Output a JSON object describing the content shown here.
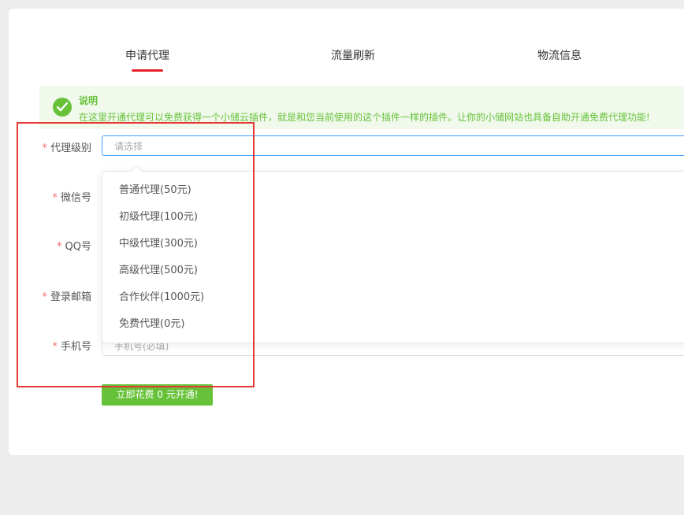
{
  "tabs": [
    {
      "label": "申请代理"
    },
    {
      "label": "流量刷新"
    },
    {
      "label": "物流信息"
    }
  ],
  "notice": {
    "title": "说明",
    "text": "在这里开通代理可以免费获得一个小储云插件，就是和您当前使用的这个插件一样的插件。让你的小储网站也具备自助开通免费代理功能!"
  },
  "form": {
    "required_mark": "*",
    "level": {
      "label": "代理级别",
      "placeholder": "请选择"
    },
    "wechat": {
      "label": "微信号"
    },
    "qq": {
      "label": "QQ号"
    },
    "email": {
      "label": "登录邮箱"
    },
    "phone": {
      "label": "手机号",
      "placeholder": "手机号(必填)"
    },
    "submit_label": "立即花费 0 元开通!"
  },
  "dropdown": {
    "options": [
      "普通代理(50元)",
      "初级代理(100元)",
      "中级代理(300元)",
      "高级代理(500元)",
      "合作伙伴(1000元)",
      "免费代理(0元)"
    ]
  },
  "colors": {
    "accent_red": "#e5202b",
    "success_green": "#67c23a",
    "focus_blue": "#409eff"
  }
}
